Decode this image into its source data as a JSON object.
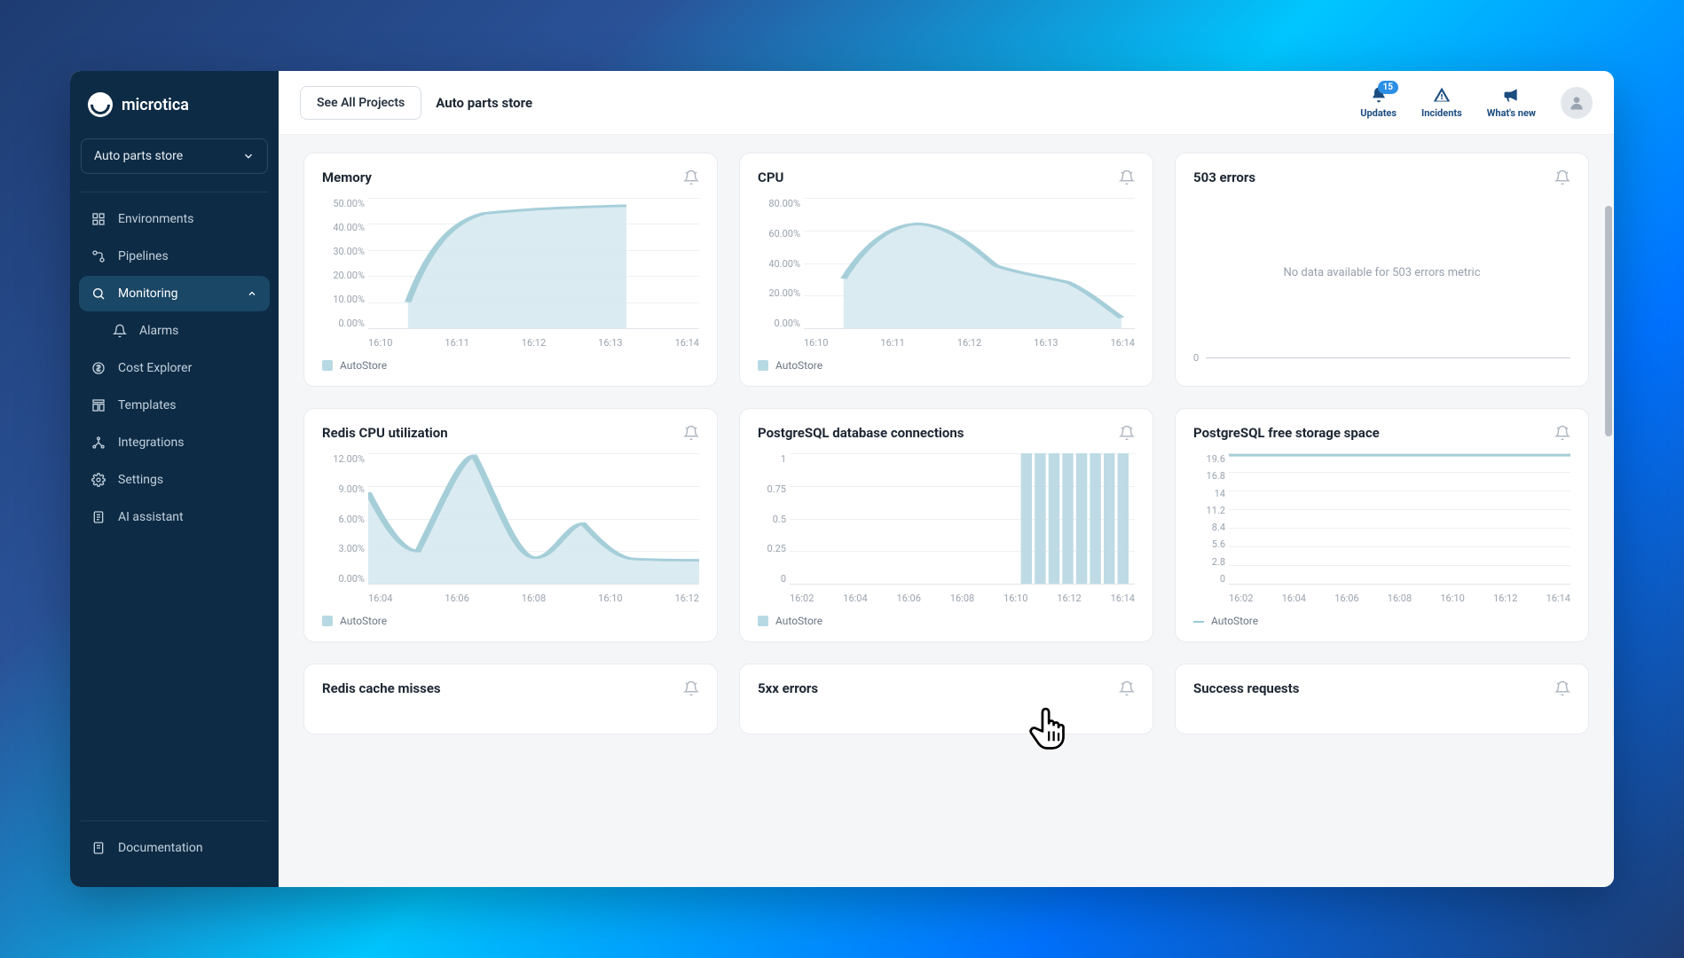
{
  "brand": "microtica",
  "project_selector": {
    "label": "Auto parts store"
  },
  "sidebar": {
    "items": [
      {
        "label": "Environments",
        "icon": "grid"
      },
      {
        "label": "Pipelines",
        "icon": "flow"
      },
      {
        "label": "Monitoring",
        "icon": "search",
        "active": true,
        "expandable": true,
        "children": [
          {
            "label": "Alarms",
            "icon": "alarm"
          }
        ]
      },
      {
        "label": "Cost Explorer",
        "icon": "dollar"
      },
      {
        "label": "Templates",
        "icon": "templates"
      },
      {
        "label": "Integrations",
        "icon": "integrations"
      },
      {
        "label": "Settings",
        "icon": "gear"
      },
      {
        "label": "AI assistant",
        "icon": "doc"
      }
    ],
    "bottom": {
      "label": "Documentation",
      "icon": "doc"
    }
  },
  "topbar": {
    "see_all": "See All Projects",
    "breadcrumb": "Auto parts store",
    "updates": {
      "label": "Updates",
      "badge": "15"
    },
    "incidents": {
      "label": "Incidents"
    },
    "whatsnew": {
      "label": "What's new"
    }
  },
  "cards": {
    "memory": {
      "title": "Memory",
      "legend": "AutoStore"
    },
    "cpu": {
      "title": "CPU",
      "legend": "AutoStore"
    },
    "e503": {
      "title": "503 errors",
      "no_data": "No data available for 503 errors metric",
      "zero": "0"
    },
    "redis": {
      "title": "Redis CPU utilization",
      "legend": "AutoStore"
    },
    "pgconn": {
      "title": "PostgreSQL database connections",
      "legend": "AutoStore"
    },
    "pgstore": {
      "title": "PostgreSQL free storage space",
      "legend": "AutoStore"
    },
    "redismiss": {
      "title": "Redis cache misses"
    },
    "e5xx": {
      "title": "5xx errors"
    },
    "success": {
      "title": "Success requests"
    }
  },
  "chart_data": [
    {
      "id": "memory",
      "type": "area",
      "ylabel": "",
      "ylim": [
        0,
        50
      ],
      "yticks": [
        "50.00%",
        "40.00%",
        "30.00%",
        "20.00%",
        "10.00%",
        "0.00%"
      ],
      "x": [
        "16:10",
        "16:11",
        "16:12",
        "16:13",
        "16:14"
      ],
      "series": [
        {
          "name": "AutoStore",
          "values": [
            10,
            38,
            42,
            44,
            45,
            46,
            47,
            47
          ]
        }
      ],
      "note": "starts low ~16:10 then plateaus ~45-47%"
    },
    {
      "id": "cpu",
      "type": "area",
      "ylim": [
        0,
        80
      ],
      "yticks": [
        "80.00%",
        "60.00%",
        "40.00%",
        "20.00%",
        "0.00%"
      ],
      "x": [
        "16:10",
        "16:11",
        "16:12",
        "16:13",
        "16:14"
      ],
      "series": [
        {
          "name": "AutoStore",
          "values": [
            30,
            55,
            64,
            50,
            40,
            36,
            33,
            20,
            8
          ]
        }
      ],
      "note": "peak ~64% around 16:11 then decays to ~8%"
    },
    {
      "id": "e503",
      "type": "line",
      "empty": true
    },
    {
      "id": "redis",
      "type": "area",
      "ylim": [
        0,
        12
      ],
      "yticks": [
        "12.00%",
        "9.00%",
        "6.00%",
        "3.00%",
        "0.00%"
      ],
      "x": [
        "16:04",
        "16:06",
        "16:08",
        "16:10",
        "16:12"
      ],
      "series": [
        {
          "name": "AutoStore",
          "values": [
            8.5,
            5.0,
            3.0,
            11.8,
            6.0,
            2.5,
            2.2,
            5.5,
            3.0,
            2.3,
            2.2
          ]
        }
      ],
      "note": "spike ~11.8% near 16:06, bump ~5.5% near 16:10, tails ~2.3%"
    },
    {
      "id": "pgconn",
      "type": "bar",
      "ylim": [
        0,
        1
      ],
      "yticks": [
        "1",
        "0.75",
        "0.5",
        "0.25",
        "0"
      ],
      "x": [
        "16:02",
        "16:04",
        "16:06",
        "16:08",
        "16:10",
        "16:12",
        "16:14"
      ],
      "series": [
        {
          "name": "AutoStore",
          "values": [
            0,
            0,
            0,
            0,
            0,
            0,
            0,
            0,
            0,
            0,
            0,
            0,
            0,
            0,
            0,
            0,
            0,
            0,
            0,
            1,
            1,
            1,
            1,
            1,
            1,
            1,
            1
          ]
        }
      ],
      "note": "zero until ~16:10 then bars at value 1 through 16:14"
    },
    {
      "id": "pgstore",
      "type": "line",
      "ylim": [
        0,
        19.6
      ],
      "yticks": [
        "19.6",
        "16.8",
        "14",
        "11.2",
        "8.4",
        "5.6",
        "2.8",
        "0"
      ],
      "x": [
        "16:02",
        "16:04",
        "16:06",
        "16:08",
        "16:10",
        "16:12",
        "16:14"
      ],
      "series": [
        {
          "name": "AutoStore",
          "values": [
            19.4,
            19.4,
            19.4,
            19.4,
            19.4,
            19.4,
            19.4
          ]
        }
      ],
      "note": "flat near top ~19.4"
    }
  ]
}
